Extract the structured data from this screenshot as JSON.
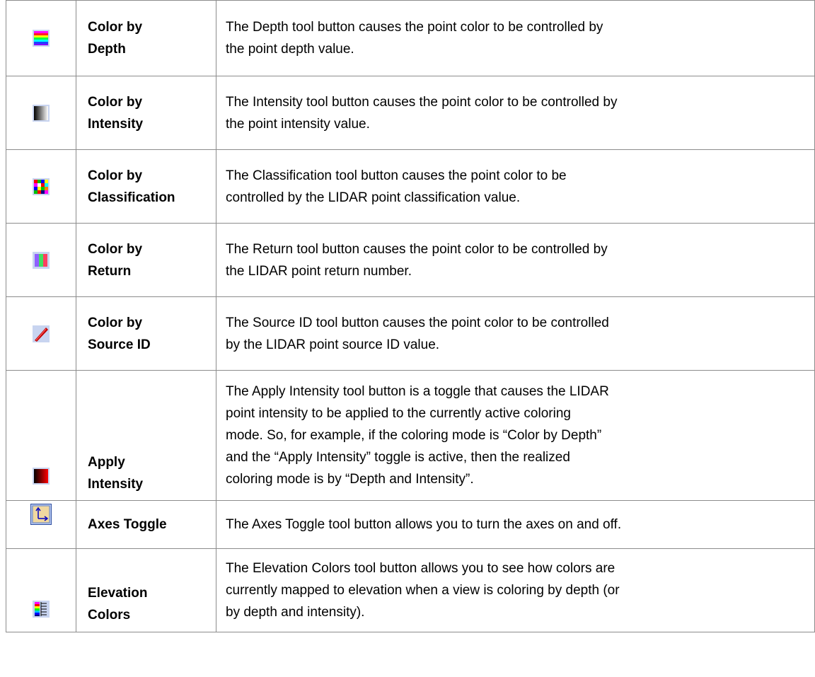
{
  "rows": [
    {
      "icon": "color-by-depth-icon",
      "name": "Color by\nDepth",
      "description": "The Depth tool button causes the point color to be controlled by\nthe point depth value."
    },
    {
      "icon": "color-by-intensity-icon",
      "name": "Color by\nIntensity",
      "description": "The Intensity tool button causes the point color to be controlled by\nthe point intensity value."
    },
    {
      "icon": "color-by-classification-icon",
      "name": "Color by\nClassification",
      "description": "The Classification tool button causes the point color to be\ncontrolled by the LIDAR point classification value."
    },
    {
      "icon": "color-by-return-icon",
      "name": "Color by\nReturn",
      "description": "The Return tool button causes the point color to be controlled by\nthe LIDAR point return number."
    },
    {
      "icon": "color-by-source-id-icon",
      "name": "Color by\nSource ID",
      "description": "The Source ID tool button causes the point color to be controlled\nby the LIDAR point source ID value."
    },
    {
      "icon": "apply-intensity-icon",
      "name": "Apply\nIntensity",
      "description": "The Apply Intensity tool button is a toggle that causes the LIDAR\npoint intensity to be applied to the currently active coloring\nmode.  So, for example, if the coloring mode is “Color by Depth”\nand the “Apply Intensity” toggle is active, then the realized\ncoloring mode is by “Depth and Intensity”."
    },
    {
      "icon": "axes-toggle-icon",
      "name": "Axes Toggle",
      "description": "The Axes Toggle tool button allows you to turn the axes on and off."
    },
    {
      "icon": "elevation-colors-icon",
      "name": "Elevation\nColors",
      "description": "The Elevation Colors tool button allows you to see how colors are\ncurrently mapped to elevation when a view is coloring by depth (or\nby depth and intensity)."
    }
  ]
}
